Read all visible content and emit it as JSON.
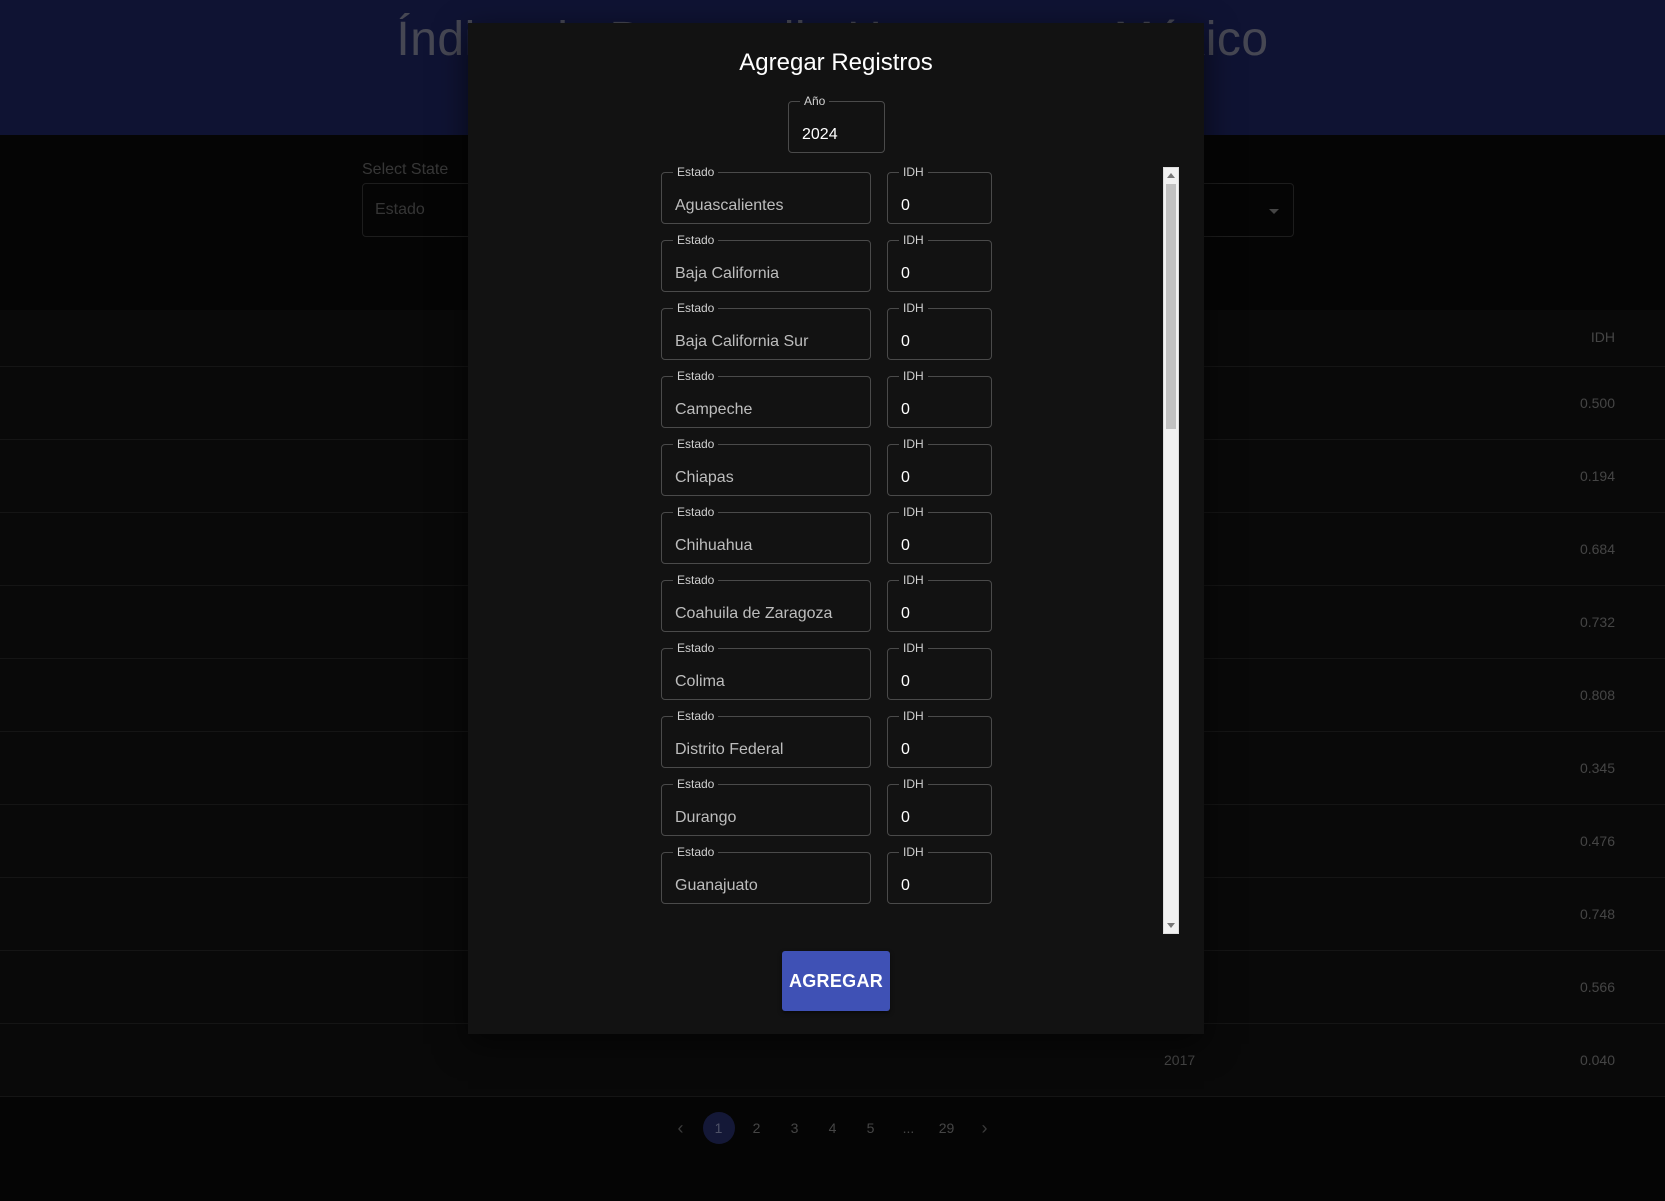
{
  "page": {
    "title": "Índice de Desarrollo Humano en México",
    "filters": {
      "state_label": "Select State",
      "state_placeholder": "Estado"
    },
    "table": {
      "idh_header": "IDH",
      "rows": [
        {
          "year": "",
          "idh": "0.500"
        },
        {
          "year": "",
          "idh": "0.194"
        },
        {
          "year": "",
          "idh": "0.684"
        },
        {
          "year": "",
          "idh": "0.732"
        },
        {
          "year": "",
          "idh": "0.808"
        },
        {
          "year": "",
          "idh": "0.345"
        },
        {
          "year": "",
          "idh": "0.476"
        },
        {
          "year": "",
          "idh": "0.748"
        },
        {
          "year": "",
          "idh": "0.566"
        },
        {
          "year": "2017",
          "idh": "0.040"
        }
      ]
    },
    "pagination": {
      "prev": "‹",
      "next": "›",
      "pages": [
        "1",
        "2",
        "3",
        "4",
        "5",
        "...",
        "29"
      ],
      "active": "1"
    }
  },
  "modal": {
    "title": "Agregar Registros",
    "year_label": "Año",
    "year_value": "2024",
    "estado_label": "Estado",
    "idh_label": "IDH",
    "rows": [
      {
        "estado": "Aguascalientes",
        "idh": "0"
      },
      {
        "estado": "Baja California",
        "idh": "0"
      },
      {
        "estado": "Baja California Sur",
        "idh": "0"
      },
      {
        "estado": "Campeche",
        "idh": "0"
      },
      {
        "estado": "Chiapas",
        "idh": "0"
      },
      {
        "estado": "Chihuahua",
        "idh": "0"
      },
      {
        "estado": "Coahuila de Zaragoza",
        "idh": "0"
      },
      {
        "estado": "Colima",
        "idh": "0"
      },
      {
        "estado": "Distrito Federal",
        "idh": "0"
      },
      {
        "estado": "Durango",
        "idh": "0"
      },
      {
        "estado": "Guanajuato",
        "idh": "0"
      }
    ],
    "submit_label": "AGREGAR"
  }
}
